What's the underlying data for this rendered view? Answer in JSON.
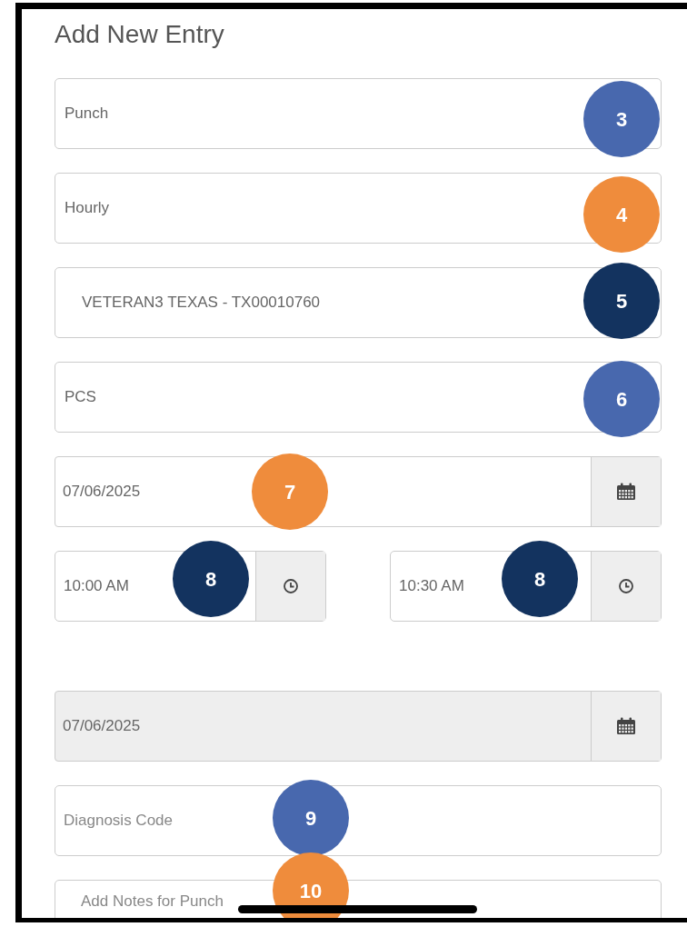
{
  "title": "Add New Entry",
  "fields": [
    {
      "kind": "select",
      "value": "Punch",
      "disabled": false,
      "badge": {
        "number": "3",
        "color": "#4868ae"
      }
    },
    {
      "kind": "select",
      "value": "Hourly",
      "disabled": false,
      "badge": {
        "number": "4",
        "color": "#ef8c3c"
      }
    },
    {
      "kind": "select",
      "value": "VETERAN3 TEXAS - TX00010760",
      "disabled": false,
      "badge": {
        "number": "5",
        "color": "#13335f"
      }
    },
    {
      "kind": "select",
      "value": "PCS",
      "disabled": false,
      "badge": {
        "number": "6",
        "color": "#4868ae"
      }
    },
    {
      "kind": "date",
      "value": "07/06/2025",
      "disabled": false,
      "badge": {
        "number": "7",
        "color": "#ef8c3c"
      }
    },
    {
      "kind": "time_pair",
      "times": [
        {
          "value": "10:00 AM",
          "badge": {
            "number": "8",
            "color": "#13335f"
          }
        },
        {
          "value": "10:30 AM",
          "badge": {
            "number": "8",
            "color": "#13335f"
          }
        }
      ]
    },
    {
      "kind": "date",
      "value": "07/06/2025",
      "disabled": true
    },
    {
      "kind": "text",
      "placeholder": "Diagnosis Code",
      "badge": {
        "number": "9",
        "color": "#4868ae"
      }
    },
    {
      "kind": "notes",
      "placeholder": "Add Notes for Punch",
      "badge": {
        "number": "10",
        "color": "#ef8c3c"
      }
    }
  ]
}
